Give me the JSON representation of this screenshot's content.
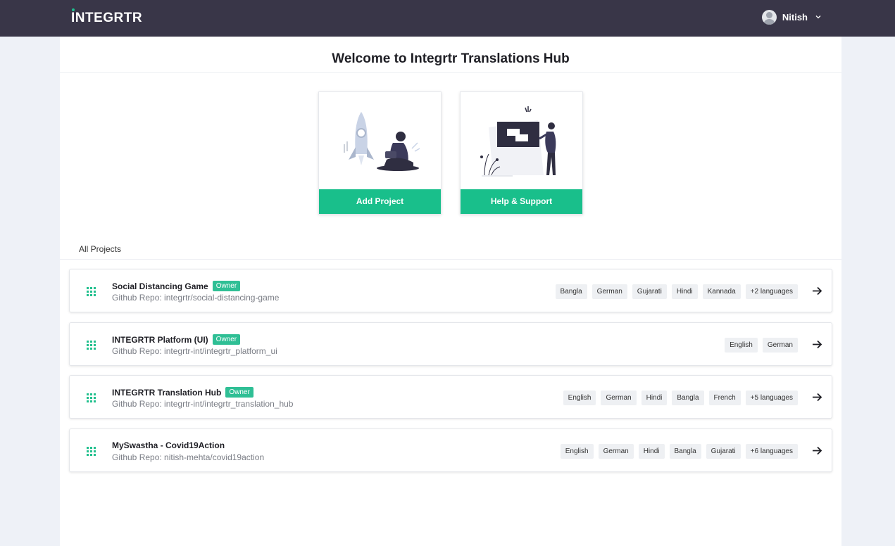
{
  "header": {
    "logo_text": "INTEGRTR",
    "user_name": "Nitish",
    "colors": {
      "background": "#393648",
      "accent": "#1fbf8f"
    }
  },
  "page": {
    "title": "Welcome to Integrtr Translations Hub"
  },
  "actions": {
    "add_project_label": "Add Project",
    "help_support_label": "Help & Support",
    "button_color": "#19bf8b"
  },
  "projects_section": {
    "label": "All Projects",
    "owner_badge": "Owner",
    "items": [
      {
        "name": "Social Distancing Game",
        "repo": "Github Repo: integrtr/social-distancing-game",
        "languages": [
          "Bangla",
          "German",
          "Gujarati",
          "Hindi",
          "Kannada",
          "+2 languages"
        ]
      },
      {
        "name": "INTEGRTR Platform (UI)",
        "repo": "Github Repo: integrtr-int/integrtr_platform_ui",
        "languages": [
          "English",
          "German"
        ]
      },
      {
        "name": "INTEGRTR Translation Hub",
        "repo": "Github Repo: integrtr-int/integrtr_translation_hub",
        "languages": [
          "English",
          "German",
          "Hindi",
          "Bangla",
          "French",
          "+5 languages"
        ]
      },
      {
        "name": "MySwastha - Covid19Action",
        "repo": "Github Repo: nitish-mehta/covid19action",
        "languages": [
          "English",
          "German",
          "Hindi",
          "Bangla",
          "Gujarati",
          "+6 languages"
        ]
      }
    ]
  }
}
